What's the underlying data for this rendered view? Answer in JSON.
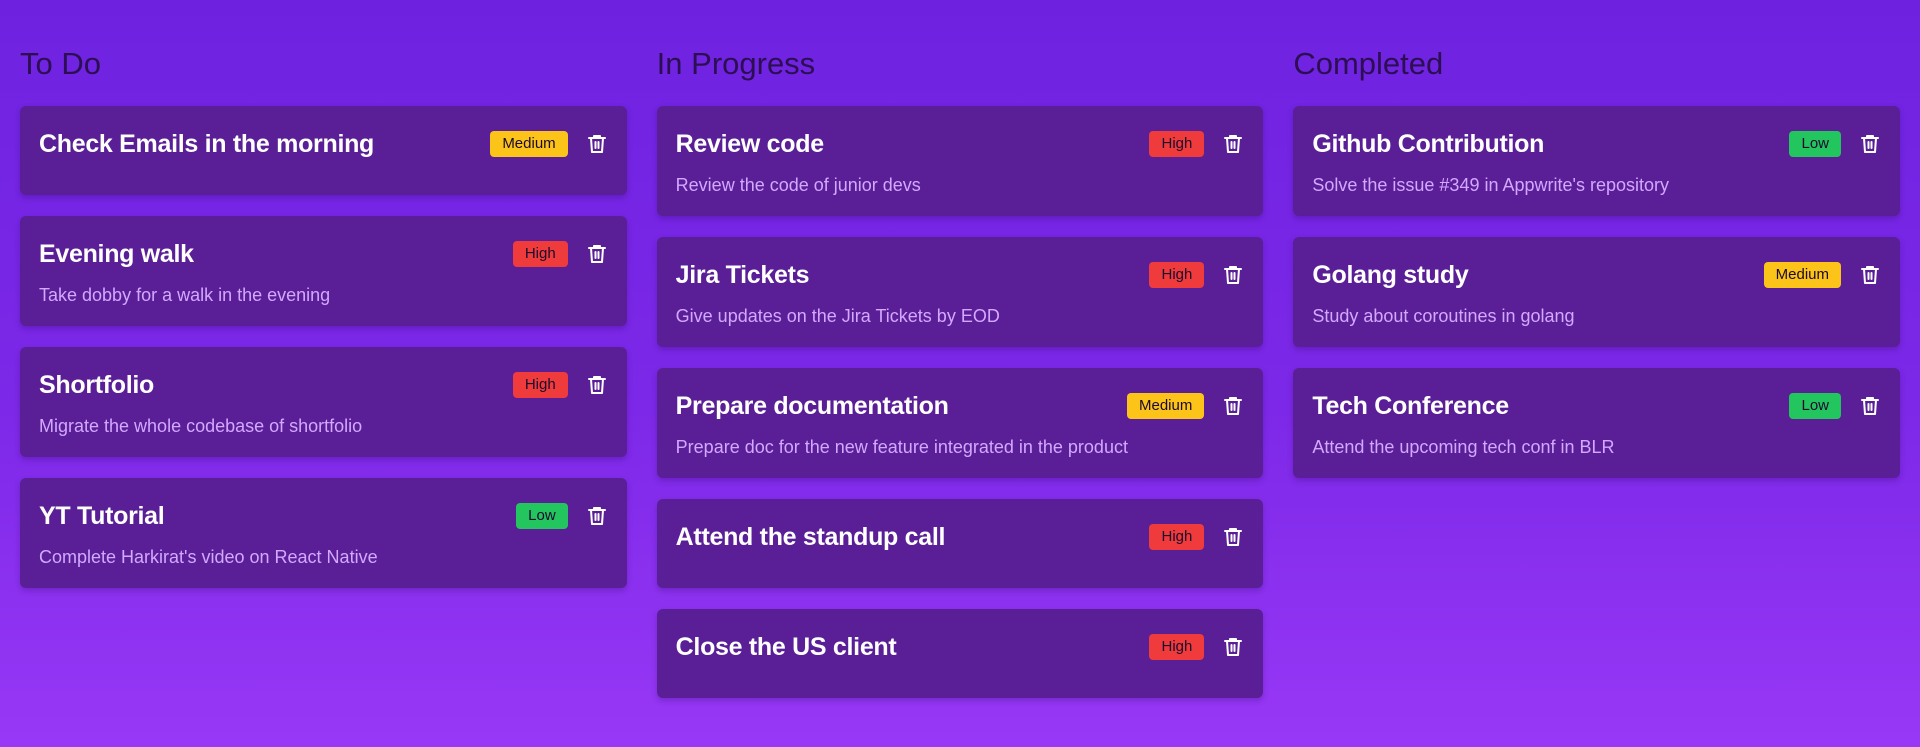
{
  "colors": {
    "background_top": "#6e22e0",
    "background_bottom": "#9838f6",
    "card": "#5a1f96",
    "column_title": "#2c0f52",
    "card_title": "#ffffff",
    "card_desc": "#d3a8ff",
    "priority_high": "#ef3b3b",
    "priority_medium": "#fcc419",
    "priority_low": "#22c55e"
  },
  "icons": {
    "delete": "trash-icon"
  },
  "columns": [
    {
      "title": "To Do",
      "cards": [
        {
          "title": "Check Emails in the morning",
          "priority": "Medium",
          "description": ""
        },
        {
          "title": "Evening walk",
          "priority": "High",
          "description": "Take dobby for a walk in the evening"
        },
        {
          "title": "Shortfolio",
          "priority": "High",
          "description": "Migrate the whole codebase of shortfolio"
        },
        {
          "title": "YT Tutorial",
          "priority": "Low",
          "description": "Complete Harkirat's video on React Native"
        }
      ]
    },
    {
      "title": "In Progress",
      "cards": [
        {
          "title": "Review code",
          "priority": "High",
          "description": "Review the code of junior devs"
        },
        {
          "title": "Jira Tickets",
          "priority": "High",
          "description": "Give updates on the Jira Tickets by EOD"
        },
        {
          "title": "Prepare documentation",
          "priority": "Medium",
          "description": "Prepare doc for the new feature integrated in the product"
        },
        {
          "title": "Attend the standup call",
          "priority": "High",
          "description": ""
        },
        {
          "title": "Close the US client",
          "priority": "High",
          "description": ""
        }
      ]
    },
    {
      "title": "Completed",
      "cards": [
        {
          "title": "Github Contribution",
          "priority": "Low",
          "description": "Solve the issue #349 in Appwrite's repository"
        },
        {
          "title": "Golang study",
          "priority": "Medium",
          "description": "Study about coroutines in golang"
        },
        {
          "title": "Tech Conference",
          "priority": "Low",
          "description": "Attend the upcoming tech conf in BLR"
        }
      ]
    }
  ]
}
